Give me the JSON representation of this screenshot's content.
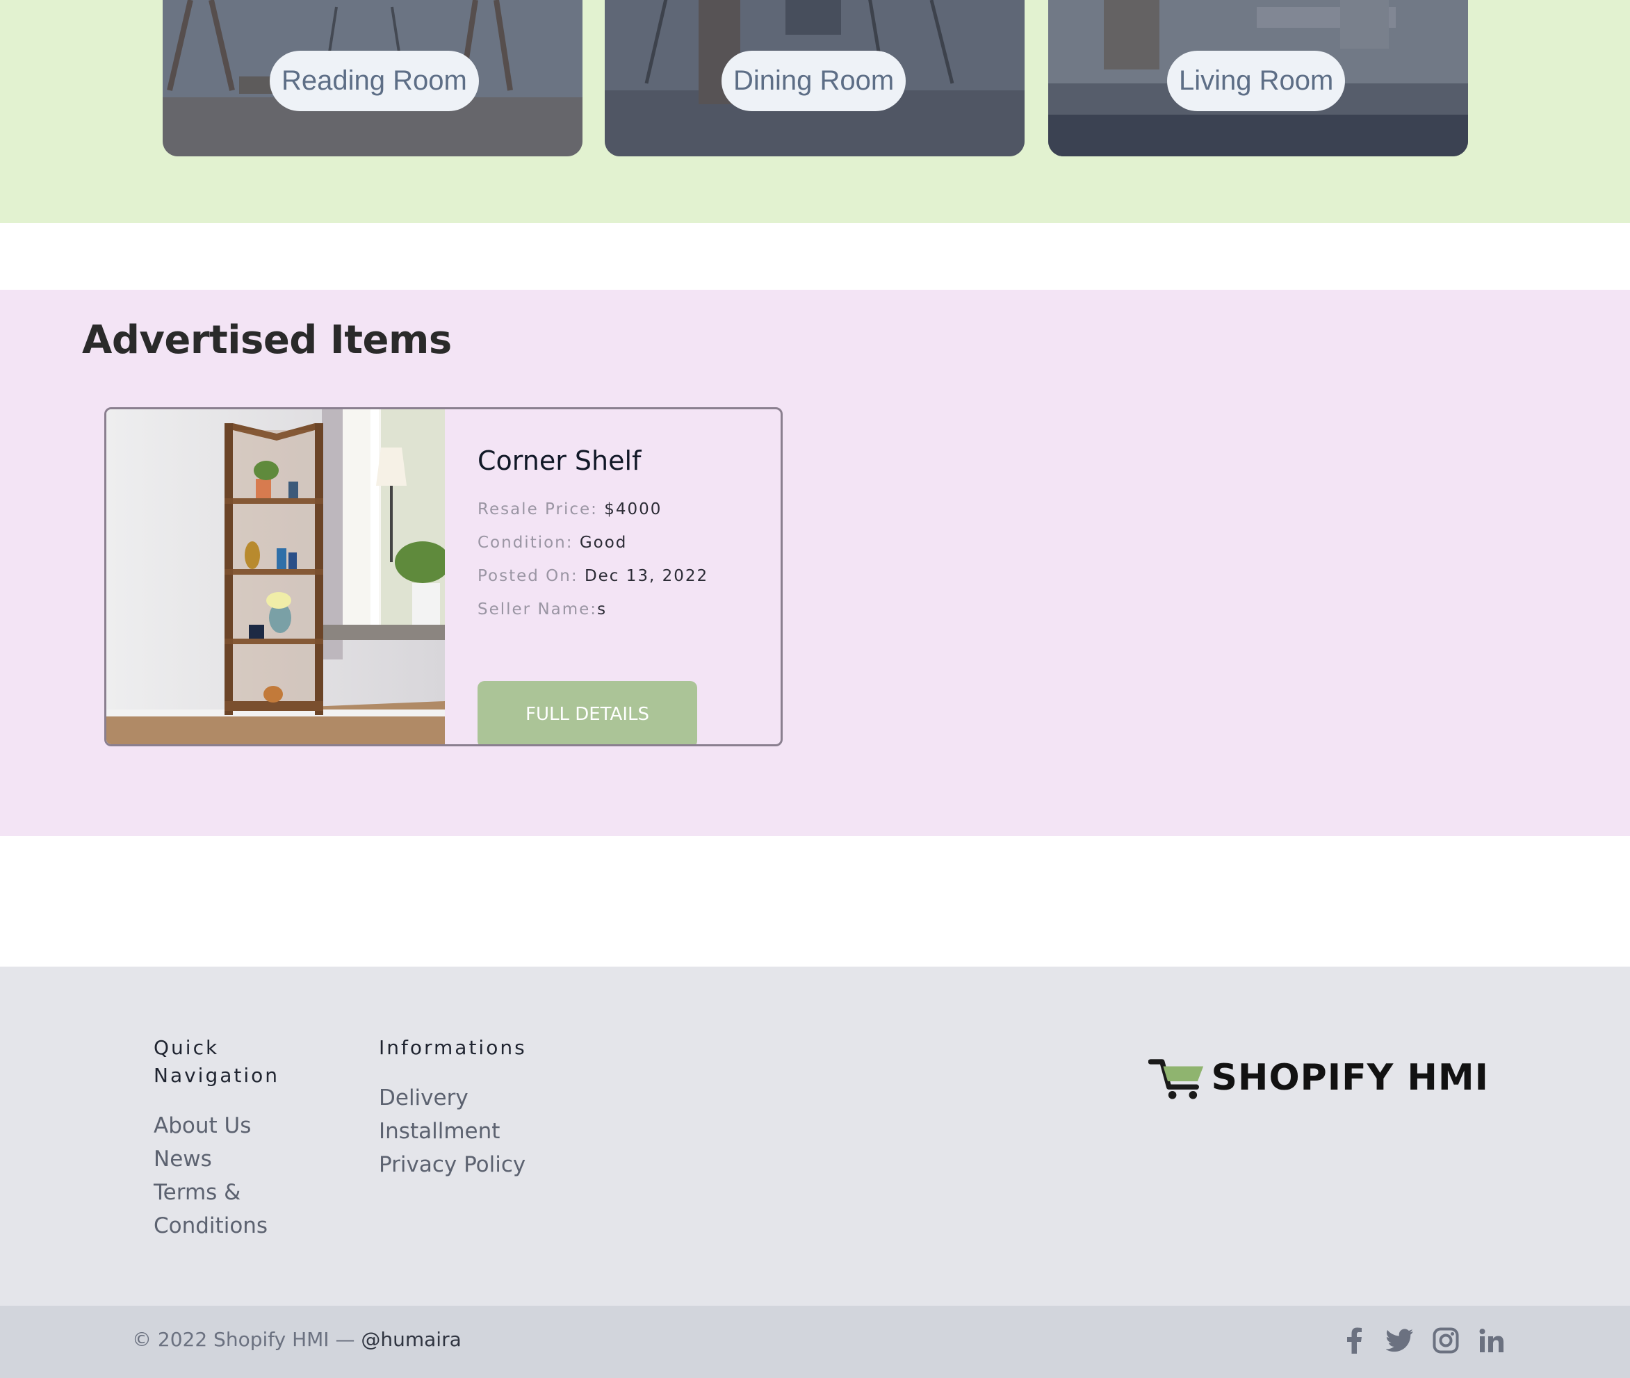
{
  "categories": [
    {
      "label": "Reading Room"
    },
    {
      "label": "Dining Room"
    },
    {
      "label": "Living Room"
    }
  ],
  "advertised": {
    "title": "Advertised Items",
    "items": [
      {
        "name": "Corner Shelf",
        "price_label": "Resale Price:",
        "price": "$4000",
        "condition_label": "Condition:",
        "condition": "Good",
        "posted_label": "Posted On:",
        "posted": "Dec 13, 2022",
        "seller_label": "Seller Name:",
        "seller": "s",
        "button": "FULL DETAILS"
      }
    ]
  },
  "footer": {
    "quick_nav": {
      "heading": "Quick Navigation",
      "links": [
        "About Us",
        "News",
        "Terms & Conditions"
      ]
    },
    "informations": {
      "heading": "Informations",
      "links": [
        "Delivery",
        "Installment",
        "Privacy Policy"
      ]
    },
    "brand": "SHOPIFY HMI",
    "copyright": "© 2022 Shopify HMI —",
    "handle": "@humaira",
    "socials": [
      "facebook-icon",
      "twitter-icon",
      "instagram-icon",
      "linkedin-icon"
    ]
  },
  "colors": {
    "categories_bg": "#e2f2d0",
    "advertised_bg": "#f3e4f5",
    "button_green": "#abc497",
    "footer_bg": "#e4e5ea",
    "bottom_bar_bg": "#d2d5dc"
  }
}
